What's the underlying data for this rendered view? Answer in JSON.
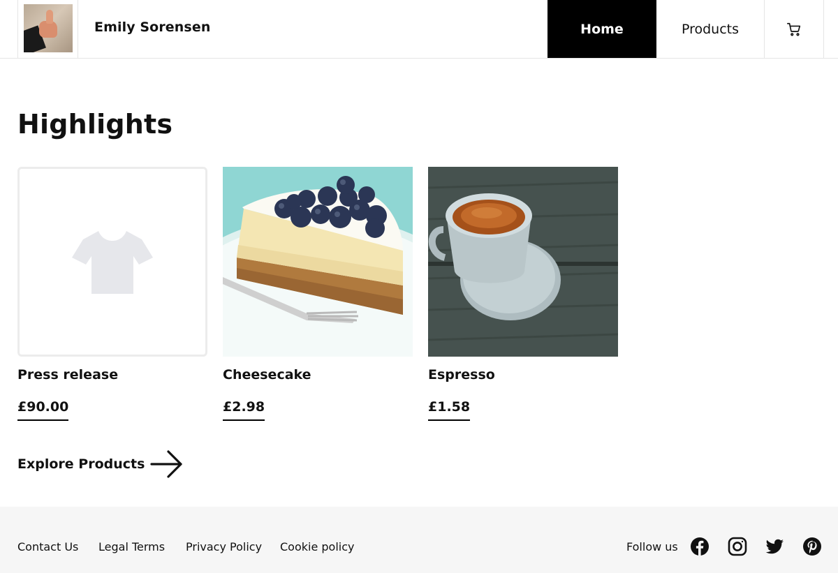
{
  "header": {
    "site_name": "Emily Sorensen",
    "nav": {
      "home": "Home",
      "products": "Products"
    }
  },
  "main": {
    "title": "Highlights",
    "products": [
      {
        "name": "Press release",
        "price": "£90.00",
        "image": "tshirt-placeholder-icon"
      },
      {
        "name": "Cheesecake",
        "price": "£2.98",
        "image": "cheesecake-photo"
      },
      {
        "name": "Espresso",
        "price": "£1.58",
        "image": "espresso-photo"
      }
    ],
    "explore_label": "Explore Products"
  },
  "footer": {
    "links": [
      "Contact Us",
      "Legal Terms",
      "Privacy Policy",
      "Cookie policy"
    ],
    "follow_label": "Follow us",
    "social": [
      "facebook-icon",
      "instagram-icon",
      "twitter-icon",
      "pinterest-icon"
    ]
  },
  "colors": {
    "accent": "#000000",
    "placeholder_icon": "#e6e7eb",
    "footer_bg": "#f6f6f6",
    "border": "#e5e5e5"
  }
}
